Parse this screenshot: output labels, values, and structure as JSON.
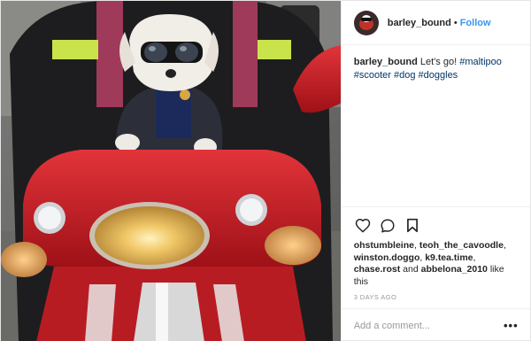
{
  "post": {
    "username": "barley_bound",
    "separator": "•",
    "follow_label": "Follow",
    "caption": {
      "username": "barley_bound",
      "text": " Let's go! ",
      "hashtags": [
        "#maltipoo",
        "#scooter",
        "#dog",
        "#doggles"
      ]
    },
    "likes": {
      "names": [
        "ohstumbleine",
        "teoh_the_cavoodle",
        "winston.doggo",
        "k9.tea.time",
        "chase.rost",
        "abbelona_2010"
      ],
      "sep1": ", ",
      "and": " and ",
      "suffix": " like this"
    },
    "timestamp": "3 DAYS AGO",
    "comment_placeholder": "Add a comment...",
    "more_label": "•••"
  },
  "icons": {
    "like": "heart-icon",
    "comment": "speech-bubble-icon",
    "save": "bookmark-icon",
    "more": "ellipsis-icon"
  },
  "colors": {
    "link": "#3897f0",
    "hashtag": "#003569",
    "muted": "#999999",
    "scooter": "#d6232b"
  }
}
